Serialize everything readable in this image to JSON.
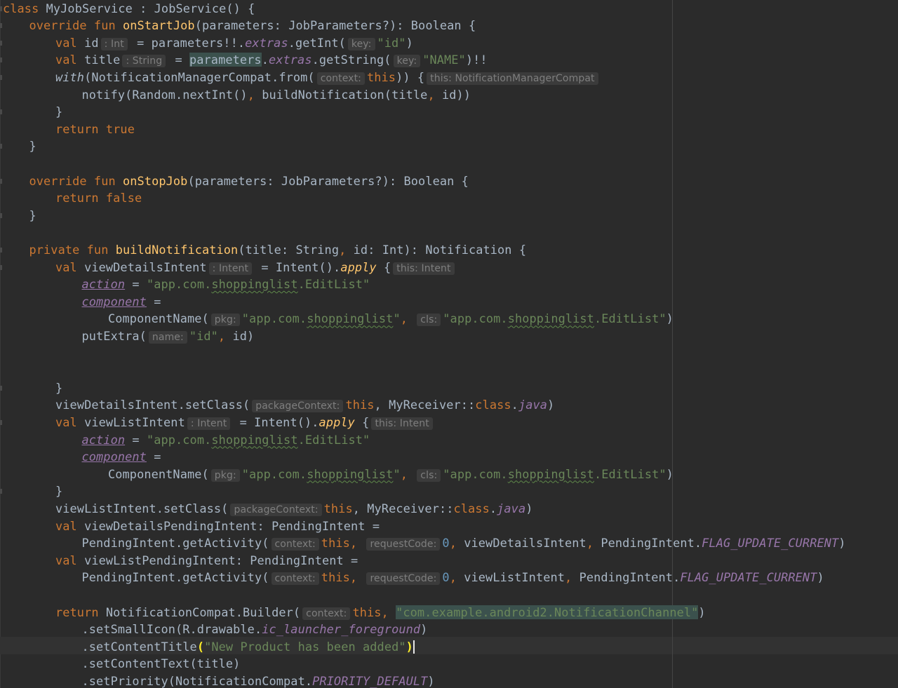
{
  "editor": {
    "theme": "darcula",
    "colors": {
      "background": "#2b2b2b",
      "keyword": "#cc7832",
      "function": "#ffc66d",
      "string": "#6a8759",
      "number": "#6897bb",
      "property": "#9876aa",
      "text": "#a9b7c6",
      "hint": "#7e7e7e"
    },
    "current_line": 37,
    "lines": [
      {
        "indent": 0,
        "tokens": [
          {
            "t": "class",
            "c": "kw"
          },
          {
            "t": " MyJobService : JobService() {"
          }
        ]
      },
      {
        "indent": 1,
        "tokens": [
          {
            "t": "override fun",
            "c": "kw"
          },
          {
            "t": " "
          },
          {
            "t": "onStartJob",
            "c": "fn"
          },
          {
            "t": "(parameters: JobParameters?): Boolean {"
          }
        ]
      },
      {
        "indent": 2,
        "tokens": [
          {
            "t": "val",
            "c": "kw"
          },
          {
            "t": " id"
          },
          {
            "t": ": Int",
            "c": "hint"
          },
          {
            "t": " = parameters!!."
          },
          {
            "t": "extras",
            "c": "prop"
          },
          {
            "t": ".getInt("
          },
          {
            "t": "key:",
            "c": "hint"
          },
          {
            "t": "\"id\"",
            "c": "str"
          },
          {
            "t": ")"
          }
        ]
      },
      {
        "indent": 2,
        "tokens": [
          {
            "t": "val",
            "c": "kw"
          },
          {
            "t": " title"
          },
          {
            "t": ": String",
            "c": "hint"
          },
          {
            "t": " = "
          },
          {
            "t": "parameters",
            "c": "hbg"
          },
          {
            "t": "."
          },
          {
            "t": "extras",
            "c": "prop"
          },
          {
            "t": ".getString("
          },
          {
            "t": "key:",
            "c": "hint"
          },
          {
            "t": "\"NAME\"",
            "c": "str"
          },
          {
            "t": ")!!"
          }
        ]
      },
      {
        "indent": 2,
        "tokens": [
          {
            "t": "with",
            "c": "it"
          },
          {
            "t": "(NotificationManagerCompat.from("
          },
          {
            "t": "context:",
            "c": "hint"
          },
          {
            "t": "this",
            "c": "kw"
          },
          {
            "t": ")) {"
          },
          {
            "t": "this: NotificationManagerCompat",
            "c": "hint"
          }
        ]
      },
      {
        "indent": 3,
        "tokens": [
          {
            "t": "notify(Random.nextInt()"
          },
          {
            "t": ",",
            "c": "kw"
          },
          {
            "t": " buildNotification(title"
          },
          {
            "t": ",",
            "c": "kw"
          },
          {
            "t": " id))"
          }
        ]
      },
      {
        "indent": 2,
        "tokens": [
          {
            "t": "}"
          }
        ]
      },
      {
        "indent": 2,
        "tokens": [
          {
            "t": "return true",
            "c": "kw"
          }
        ]
      },
      {
        "indent": 1,
        "tokens": [
          {
            "t": "}"
          }
        ]
      },
      {
        "indent": 0,
        "tokens": []
      },
      {
        "indent": 1,
        "tokens": [
          {
            "t": "override fun",
            "c": "kw"
          },
          {
            "t": " "
          },
          {
            "t": "onStopJob",
            "c": "fn"
          },
          {
            "t": "(parameters: JobParameters?): Boolean {"
          }
        ]
      },
      {
        "indent": 2,
        "tokens": [
          {
            "t": "return false",
            "c": "kw"
          }
        ]
      },
      {
        "indent": 1,
        "tokens": [
          {
            "t": "}"
          }
        ]
      },
      {
        "indent": 0,
        "tokens": []
      },
      {
        "indent": 1,
        "tokens": [
          {
            "t": "private fun",
            "c": "kw"
          },
          {
            "t": " "
          },
          {
            "t": "buildNotification",
            "c": "fn"
          },
          {
            "t": "(title: String"
          },
          {
            "t": ",",
            "c": "kw"
          },
          {
            "t": " id: Int): Notification {"
          }
        ]
      },
      {
        "indent": 2,
        "tokens": [
          {
            "t": "val",
            "c": "kw"
          },
          {
            "t": " viewDetailsIntent"
          },
          {
            "t": ": Intent",
            "c": "hint"
          },
          {
            "t": " = Intent()."
          },
          {
            "t": "apply",
            "c": "ext"
          },
          {
            "t": " {"
          },
          {
            "t": "this: Intent",
            "c": "hint"
          }
        ]
      },
      {
        "indent": 3,
        "tokens": [
          {
            "t": "action",
            "c": "fld"
          },
          {
            "t": " = "
          },
          {
            "t": "\"app.com.",
            "c": "str"
          },
          {
            "t": "shoppinglist",
            "c": "str sq"
          },
          {
            "t": ".EditList\"",
            "c": "str"
          }
        ]
      },
      {
        "indent": 3,
        "tokens": [
          {
            "t": "component",
            "c": "fld"
          },
          {
            "t": " ="
          }
        ]
      },
      {
        "indent": 4,
        "tokens": [
          {
            "t": "ComponentName("
          },
          {
            "t": "pkg:",
            "c": "hint"
          },
          {
            "t": "\"app.com.",
            "c": "str"
          },
          {
            "t": "shoppinglist",
            "c": "str sq"
          },
          {
            "t": "\"",
            "c": "str"
          },
          {
            "t": ",",
            "c": "kw"
          },
          {
            "t": " "
          },
          {
            "t": "cls:",
            "c": "hint"
          },
          {
            "t": "\"app.com.",
            "c": "str"
          },
          {
            "t": "shoppinglist",
            "c": "str sq"
          },
          {
            "t": ".EditList\"",
            "c": "str"
          },
          {
            "t": ")"
          }
        ]
      },
      {
        "indent": 3,
        "tokens": [
          {
            "t": "putExtra("
          },
          {
            "t": "name:",
            "c": "hint"
          },
          {
            "t": "\"id\"",
            "c": "str"
          },
          {
            "t": ",",
            "c": "kw"
          },
          {
            "t": " id)"
          }
        ]
      },
      {
        "indent": 0,
        "tokens": []
      },
      {
        "indent": 0,
        "tokens": []
      },
      {
        "indent": 2,
        "tokens": [
          {
            "t": "}"
          }
        ]
      },
      {
        "indent": 2,
        "tokens": [
          {
            "t": "viewDetailsIntent.setClass("
          },
          {
            "t": "packageContext:",
            "c": "hint"
          },
          {
            "t": "this",
            "c": "kw"
          },
          {
            "t": ","
          },
          {
            "t": " MyReceiver::"
          },
          {
            "t": "class",
            "c": "kw"
          },
          {
            "t": "."
          },
          {
            "t": "java",
            "c": "prop"
          },
          {
            "t": ")"
          }
        ]
      },
      {
        "indent": 2,
        "tokens": [
          {
            "t": "val",
            "c": "kw"
          },
          {
            "t": " viewListIntent"
          },
          {
            "t": ": Intent",
            "c": "hint"
          },
          {
            "t": " = Intent()."
          },
          {
            "t": "apply",
            "c": "ext"
          },
          {
            "t": " {"
          },
          {
            "t": "this: Intent",
            "c": "hint"
          }
        ]
      },
      {
        "indent": 3,
        "tokens": [
          {
            "t": "action",
            "c": "fld"
          },
          {
            "t": " = "
          },
          {
            "t": "\"app.com.",
            "c": "str"
          },
          {
            "t": "shoppinglist",
            "c": "str sq"
          },
          {
            "t": ".EditList\"",
            "c": "str"
          }
        ]
      },
      {
        "indent": 3,
        "tokens": [
          {
            "t": "component",
            "c": "fld"
          },
          {
            "t": " ="
          }
        ]
      },
      {
        "indent": 4,
        "tokens": [
          {
            "t": "ComponentName("
          },
          {
            "t": "pkg:",
            "c": "hint"
          },
          {
            "t": "\"app.com.",
            "c": "str"
          },
          {
            "t": "shoppinglist",
            "c": "str sq"
          },
          {
            "t": "\"",
            "c": "str"
          },
          {
            "t": ",",
            "c": "kw"
          },
          {
            "t": " "
          },
          {
            "t": "cls:",
            "c": "hint"
          },
          {
            "t": "\"app.com.",
            "c": "str"
          },
          {
            "t": "shoppinglist",
            "c": "str sq"
          },
          {
            "t": ".EditList\"",
            "c": "str"
          },
          {
            "t": ")"
          }
        ]
      },
      {
        "indent": 2,
        "tokens": [
          {
            "t": "}"
          }
        ]
      },
      {
        "indent": 2,
        "tokens": [
          {
            "t": "viewListIntent.setClass("
          },
          {
            "t": "packageContext:",
            "c": "hint"
          },
          {
            "t": "this",
            "c": "kw"
          },
          {
            "t": ","
          },
          {
            "t": " MyReceiver::"
          },
          {
            "t": "class",
            "c": "kw"
          },
          {
            "t": "."
          },
          {
            "t": "java",
            "c": "prop"
          },
          {
            "t": ")"
          }
        ]
      },
      {
        "indent": 2,
        "tokens": [
          {
            "t": "val",
            "c": "kw"
          },
          {
            "t": " viewDetailsPendingIntent: PendingIntent ="
          }
        ]
      },
      {
        "indent": 3,
        "tokens": [
          {
            "t": "PendingIntent.getActivity("
          },
          {
            "t": "context:",
            "c": "hint"
          },
          {
            "t": "this",
            "c": "kw"
          },
          {
            "t": ",",
            "c": "kw"
          },
          {
            "t": " "
          },
          {
            "t": "requestCode:",
            "c": "hint"
          },
          {
            "t": "0",
            "c": "num"
          },
          {
            "t": ",",
            "c": "kw"
          },
          {
            "t": " viewDetailsIntent"
          },
          {
            "t": ",",
            "c": "kw"
          },
          {
            "t": " PendingIntent."
          },
          {
            "t": "FLAG_UPDATE_CURRENT",
            "c": "prop"
          },
          {
            "t": ")"
          }
        ]
      },
      {
        "indent": 2,
        "tokens": [
          {
            "t": "val",
            "c": "kw"
          },
          {
            "t": " viewListPendingIntent: PendingIntent ="
          }
        ]
      },
      {
        "indent": 3,
        "tokens": [
          {
            "t": "PendingIntent.getActivity("
          },
          {
            "t": "context:",
            "c": "hint"
          },
          {
            "t": "this",
            "c": "kw"
          },
          {
            "t": ",",
            "c": "kw"
          },
          {
            "t": " "
          },
          {
            "t": "requestCode:",
            "c": "hint"
          },
          {
            "t": "0",
            "c": "num"
          },
          {
            "t": ",",
            "c": "kw"
          },
          {
            "t": " viewListIntent"
          },
          {
            "t": ",",
            "c": "kw"
          },
          {
            "t": " PendingIntent."
          },
          {
            "t": "FLAG_UPDATE_CURRENT",
            "c": "prop"
          },
          {
            "t": ")"
          }
        ]
      },
      {
        "indent": 0,
        "tokens": []
      },
      {
        "indent": 2,
        "tokens": [
          {
            "t": "return",
            "c": "kw"
          },
          {
            "t": " NotificationCompat.Builder("
          },
          {
            "t": "context:",
            "c": "hint"
          },
          {
            "t": "this",
            "c": "kw"
          },
          {
            "t": ",",
            "c": "kw"
          },
          {
            "t": " "
          },
          {
            "t": "\"com.example.android2.NotificationChannel\"",
            "c": "str hbg"
          },
          {
            "t": ")"
          }
        ]
      },
      {
        "indent": 3,
        "tokens": [
          {
            "t": ".setSmallIcon(R.drawable."
          },
          {
            "t": "ic_launcher_foreground",
            "c": "prop"
          },
          {
            "t": ")"
          }
        ]
      },
      {
        "indent": 3,
        "tokens": [
          {
            "t": ".setContentTitle"
          },
          {
            "t": "(",
            "c": "hl"
          },
          {
            "t": "\"New Product has been added\"",
            "c": "str"
          },
          {
            "t": ")",
            "c": "hl"
          },
          {
            "t": "",
            "c": "caret"
          }
        ]
      },
      {
        "indent": 3,
        "tokens": [
          {
            "t": ".setContentText(title)"
          }
        ]
      },
      {
        "indent": 3,
        "tokens": [
          {
            "t": ".setPriority(NotificationCompat."
          },
          {
            "t": "PRIORITY_DEFAULT",
            "c": "prop"
          },
          {
            "t": ")"
          }
        ]
      }
    ]
  }
}
